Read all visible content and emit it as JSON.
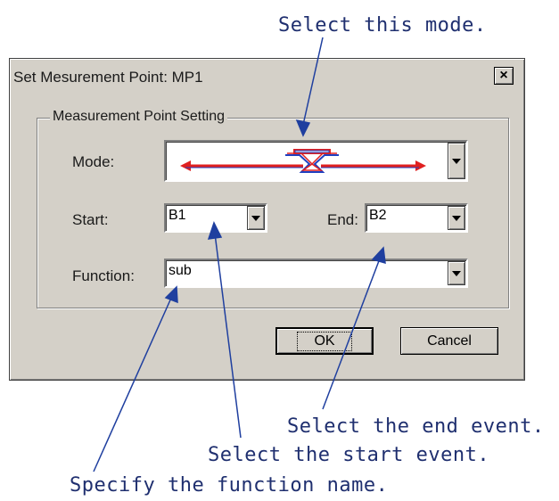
{
  "annotations": {
    "mode": "Select this mode.",
    "end_event": "Select the end event.",
    "start_event": "Select the start event.",
    "function_name": "Specify the function name."
  },
  "dialog": {
    "title": "Set Mesurement Point: MP1",
    "close_glyph": "×",
    "group_title": "Measurement Point Setting",
    "mode_label": "Mode:",
    "start_label": "Start:",
    "start_value": "B1",
    "end_label": "End:",
    "end_value": "B2",
    "function_label": "Function:",
    "function_value": "sub",
    "ok_label": "OK",
    "cancel_label": "Cancel"
  },
  "colors": {
    "annotation_text": "#1f2f6f",
    "arrow_blue": "#1f3f9f",
    "mode_red": "#e02020",
    "mode_blue": "#2040c0",
    "dialog_face": "#d4d0c8"
  }
}
